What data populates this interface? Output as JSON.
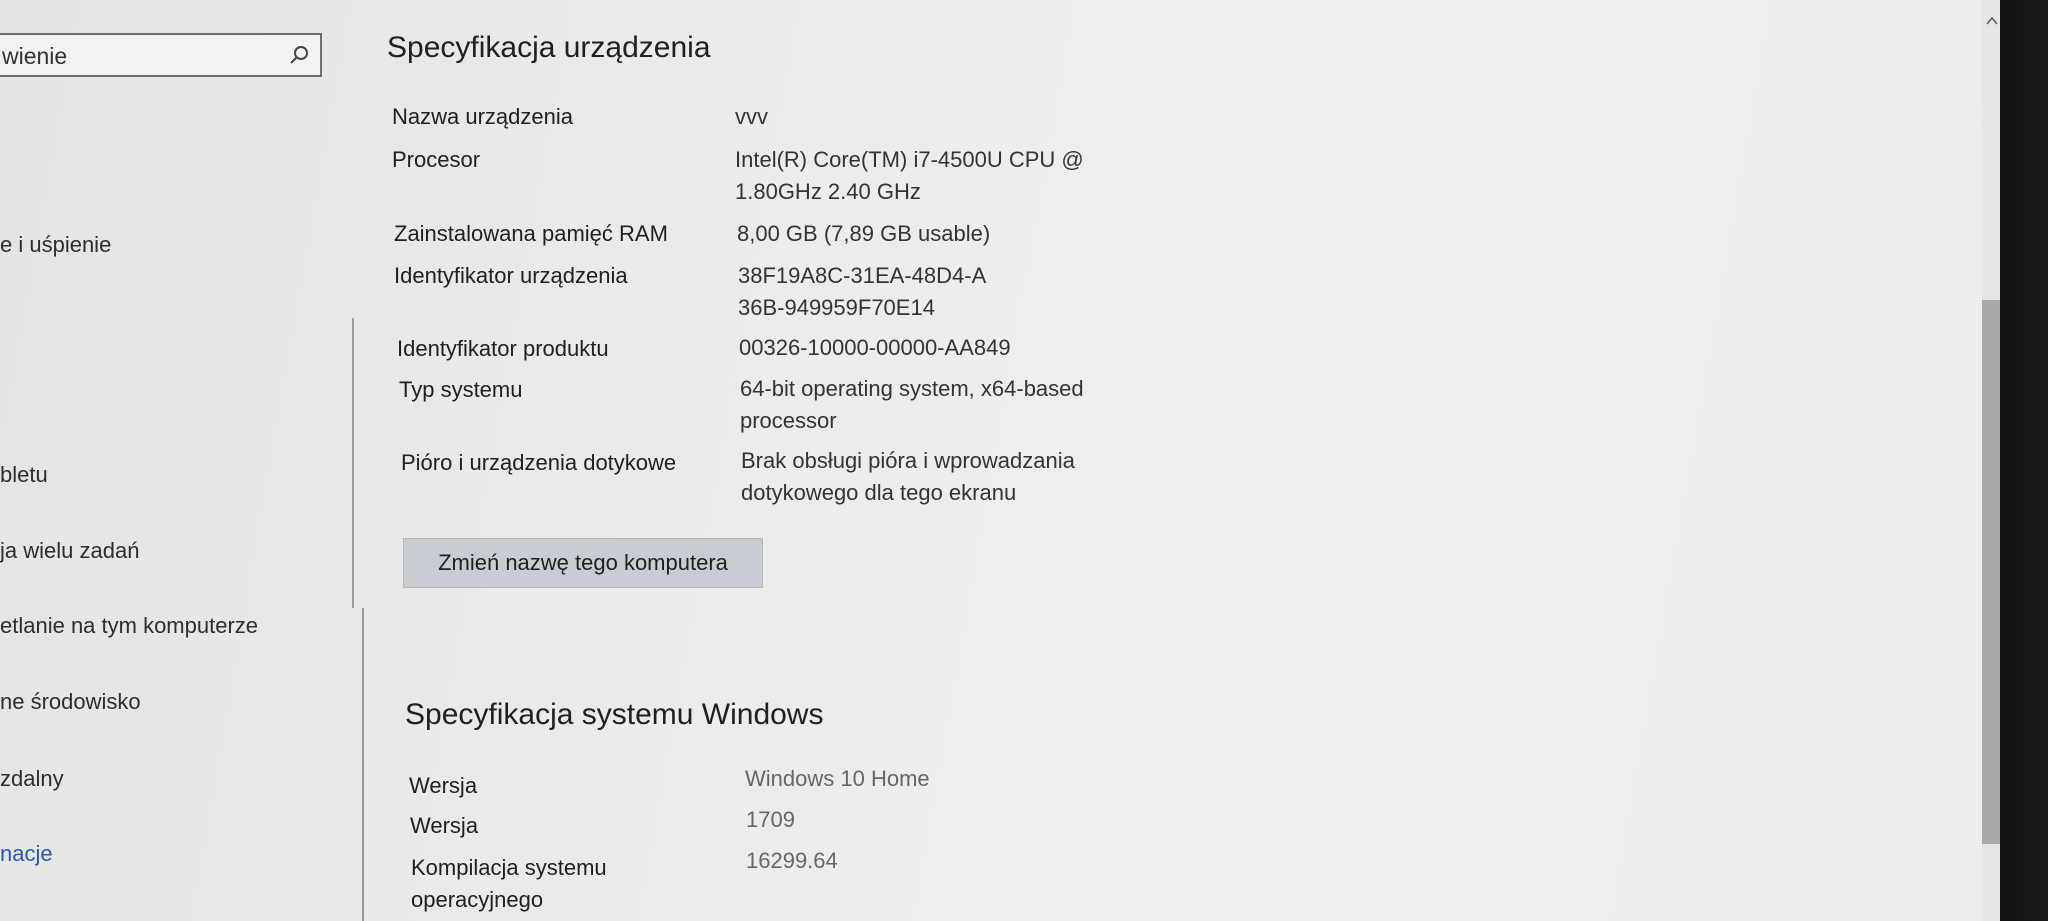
{
  "search": {
    "value": "wienie",
    "icon": "search-icon"
  },
  "sidebar": {
    "items": [
      {
        "label": "e i uśpienie"
      },
      {
        "label": "bletu"
      },
      {
        "label": "ja wielu zadań"
      },
      {
        "label": "etlanie na tym komputerze"
      },
      {
        "label": "ne środowisko"
      },
      {
        "label": "zdalny"
      },
      {
        "label": "nacje"
      }
    ]
  },
  "device_spec": {
    "title": "Specyfikacja urządzenia",
    "rows": [
      {
        "label": "Nazwa urządzenia",
        "value": "vvv"
      },
      {
        "label": "Procesor",
        "value": "Intel(R) Core(TM) i7-4500U CPU @ 1.80GHz   2.40 GHz"
      },
      {
        "label": "Zainstalowana pamięć RAM",
        "value": "8,00 GB (7,89 GB usable)"
      },
      {
        "label": "Identyfikator urządzenia",
        "value": "38F19A8C-31EA-48D4-A36B-949959F70E14"
      },
      {
        "label": "Identyfikator produktu",
        "value": "00326-10000-00000-AA849"
      },
      {
        "label": "Typ systemu",
        "value": "64-bit operating system, x64-based processor"
      },
      {
        "label": "Pióro i urządzenia dotykowe",
        "value": "Brak obsługi pióra i wprowadzania dotykowego dla tego ekranu"
      }
    ],
    "rename_button": "Zmień nazwę tego komputera"
  },
  "windows_spec": {
    "title": "Specyfikacja systemu Windows",
    "rows": [
      {
        "label": "Wersja",
        "value": "Windows 10 Home"
      },
      {
        "label": "Wersja",
        "value": "1709"
      },
      {
        "label": "Kompilacja systemu operacyjnego",
        "value": "16299.64"
      }
    ]
  }
}
